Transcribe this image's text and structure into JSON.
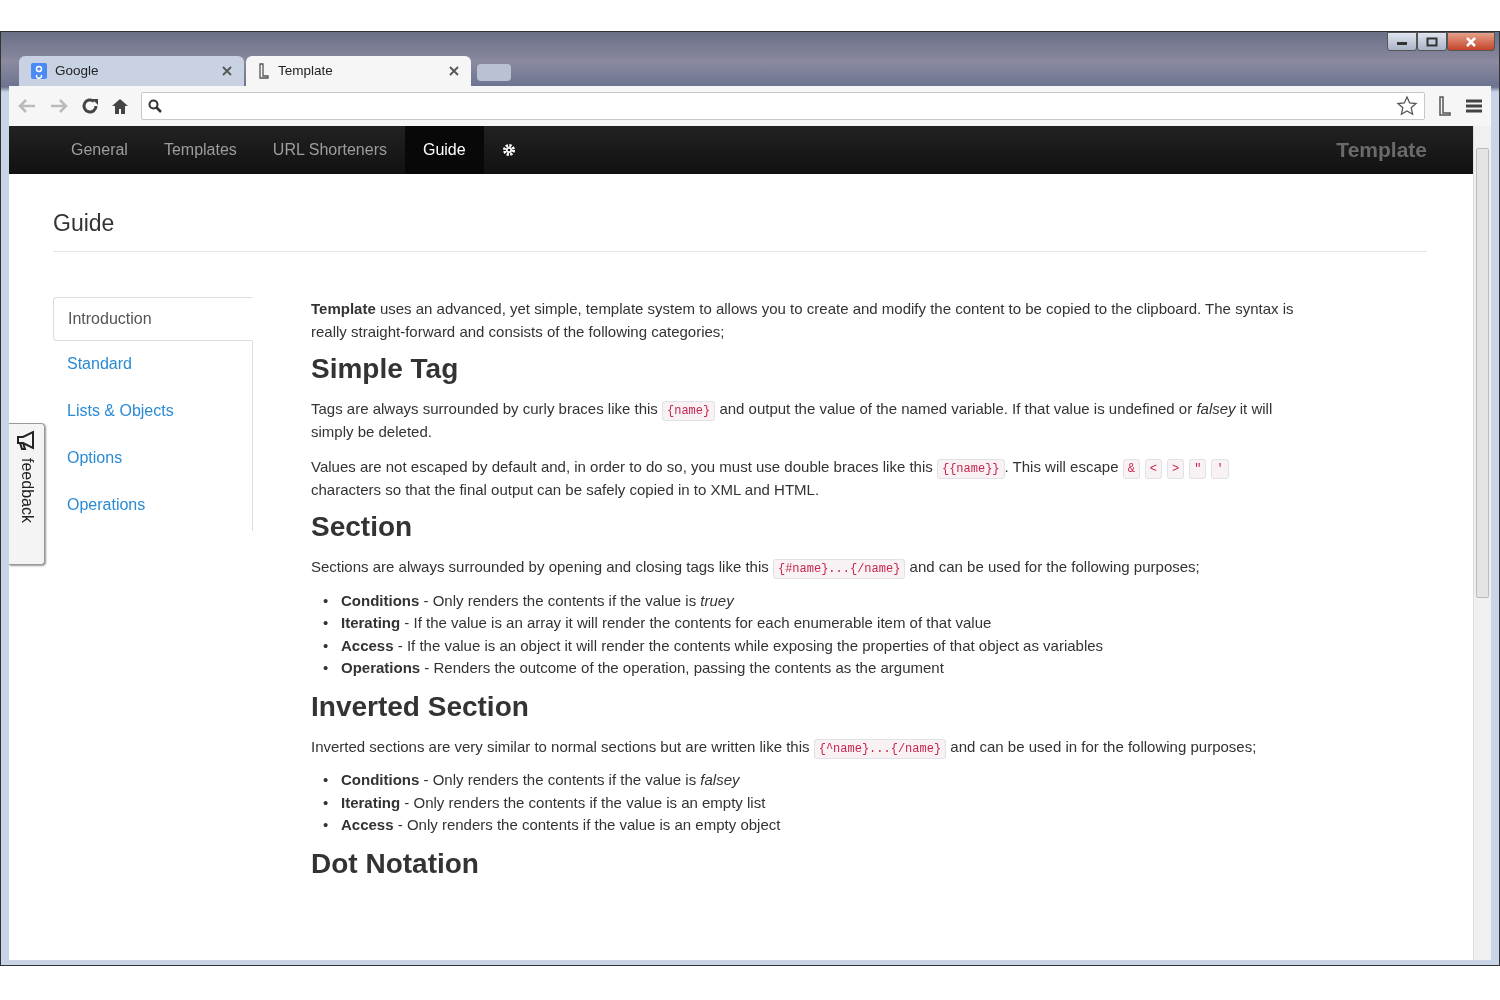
{
  "browser": {
    "tabs": [
      {
        "title": "Google",
        "selected": false
      },
      {
        "title": "Template",
        "selected": true
      }
    ]
  },
  "navbar": {
    "items": [
      {
        "label": "General",
        "kind": "text",
        "selected": false
      },
      {
        "label": "Templates",
        "kind": "text",
        "selected": false
      },
      {
        "label": "URL Shorteners",
        "kind": "text",
        "selected": false
      },
      {
        "label": "Guide",
        "kind": "text",
        "selected": true
      },
      {
        "kind": "gear",
        "selected": false
      }
    ],
    "brand": "Template"
  },
  "page": {
    "title": "Guide",
    "sidebar": {
      "items": [
        {
          "label": "Introduction",
          "selected": true
        },
        {
          "label": "Standard",
          "selected": false
        },
        {
          "label": "Lists & Objects",
          "selected": false
        },
        {
          "label": "Options",
          "selected": false
        },
        {
          "label": "Operations",
          "selected": false
        }
      ]
    },
    "feedback": {
      "label": "feedback"
    },
    "content": [
      {
        "kind": "paragraph",
        "parts": [
          {
            "kind": "text",
            "text": "**Template** uses an advanced, yet simple, template system to allows you to create and modify the content to be copied to the clipboard. The syntax is really straight-forward and consists of the following categories;"
          }
        ]
      },
      {
        "kind": "heading",
        "text": "Simple Tag"
      },
      {
        "kind": "paragraph",
        "parts": [
          {
            "kind": "text",
            "text": "Tags are always surrounded by curly braces like this "
          },
          {
            "kind": "code",
            "text": "{name}"
          },
          {
            "kind": "text",
            "text": " and output the value of the named variable. If that value is undefined or *falsey* it will simply be deleted."
          }
        ]
      },
      {
        "kind": "paragraph",
        "parts": [
          {
            "kind": "text",
            "text": "Values are not escaped by default and, in order to do so, you must use double braces like this "
          },
          {
            "kind": "code",
            "text": "{{name}}"
          },
          {
            "kind": "text",
            "text": ". This will escape "
          },
          {
            "kind": "code",
            "text": "&"
          },
          {
            "kind": "code",
            "text": "<"
          },
          {
            "kind": "code",
            "text": ">"
          },
          {
            "kind": "code",
            "text": "\""
          },
          {
            "kind": "code",
            "text": "'"
          },
          {
            "kind": "text",
            "text": " characters so that the final output can be safely copied in to XML and HTML."
          }
        ]
      },
      {
        "kind": "heading",
        "text": "Section"
      },
      {
        "kind": "paragraph",
        "parts": [
          {
            "kind": "text",
            "text": "Sections are always surrounded by opening and closing tags like this "
          },
          {
            "kind": "code",
            "text": "{#name}...{/name}"
          },
          {
            "kind": "text",
            "text": " and can be used for the following purposes;"
          }
        ]
      },
      {
        "kind": "list",
        "items": [
          {
            "marker": "•",
            "text": "**Conditions** - Only renders the contents if the value is *truey*"
          },
          {
            "marker": "•",
            "text": "**Iterating** - If the value is an array it will render the contents for each enumerable item of that value"
          },
          {
            "marker": "•",
            "text": "**Access** - If the value is an object it will render the contents while exposing the properties of that object as variables"
          },
          {
            "marker": "•",
            "text": "**Operations** - Renders the outcome of the operation, passing the contents as the argument"
          }
        ]
      },
      {
        "kind": "heading",
        "text": "Inverted Section"
      },
      {
        "kind": "paragraph",
        "parts": [
          {
            "kind": "text",
            "text": "Inverted sections are very similar to normal sections but are written like this "
          },
          {
            "kind": "code",
            "text": "{^name}...{/name}"
          },
          {
            "kind": "text",
            "text": " and can be used in for the following purposes;"
          }
        ]
      },
      {
        "kind": "list",
        "items": [
          {
            "marker": "•",
            "text": "**Conditions** - Only renders the contents if the value is *falsey*"
          },
          {
            "marker": "•",
            "text": "**Iterating** - Only renders the contents if the value is an empty list"
          },
          {
            "marker": "•",
            "text": "**Access** - Only renders the contents if the value is an empty object"
          }
        ]
      },
      {
        "kind": "heading",
        "text": "Dot Notation"
      }
    ]
  }
}
